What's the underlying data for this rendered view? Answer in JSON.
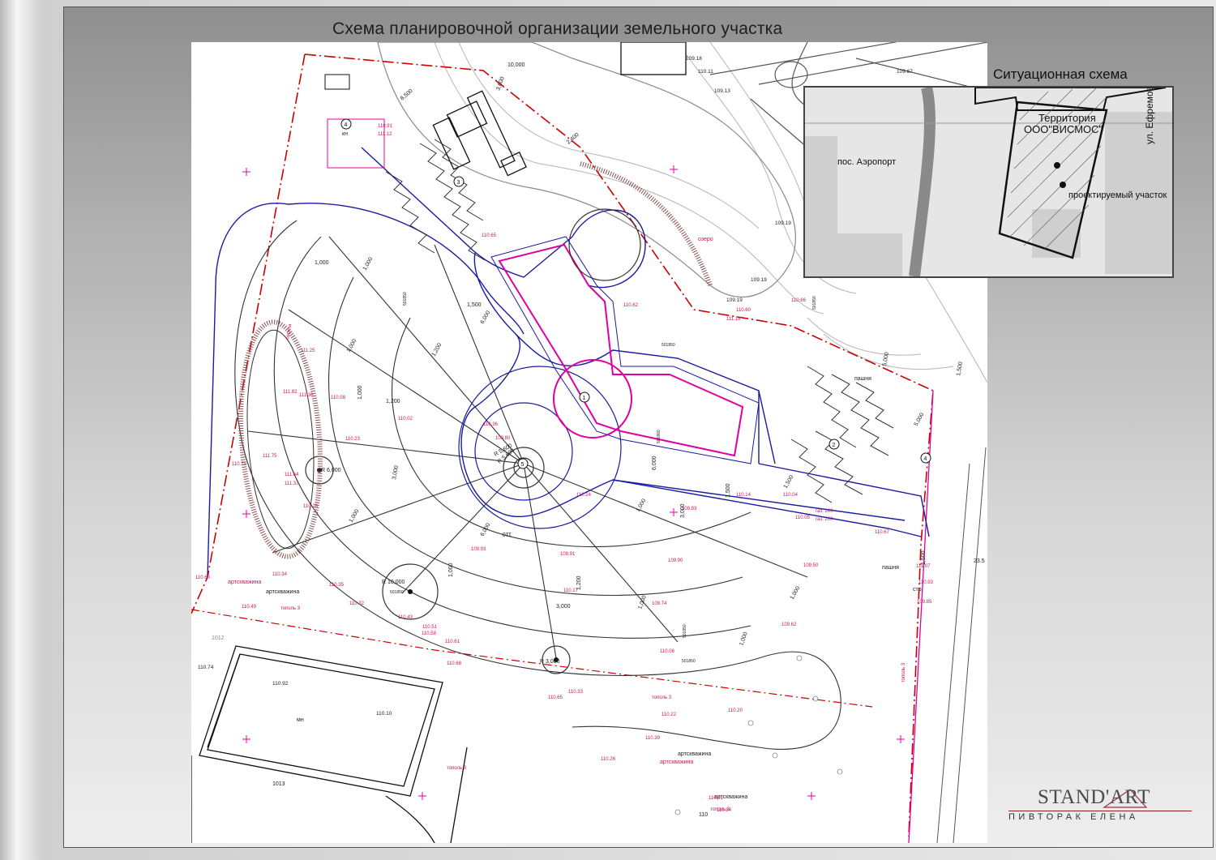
{
  "title": "Схема планировочной организации земельного участка",
  "inset": {
    "title": "Ситуационная схема",
    "territory_label": "Территория",
    "owner_label": "ООО\"ВИСМОС\"",
    "settlement_label": "пос. Аэропорт",
    "street_label": "ул. Ефремова",
    "project_site_label": "проектируемый участок"
  },
  "plan": {
    "text_labels": [
      {
        "text": "пашня",
        "color": "#222",
        "rot": 0
      },
      {
        "text": "пашня",
        "color": "#222",
        "rot": 0
      },
      {
        "text": "артскважина",
        "color": "#d4145a",
        "rot": 0
      },
      {
        "text": "артскважина",
        "color": "#222",
        "rot": 0
      },
      {
        "text": "артскважина",
        "color": "#222",
        "rot": 0
      },
      {
        "text": "артскважина",
        "color": "#222",
        "rot": 0
      },
      {
        "text": "артскважина",
        "color": "#d4145a",
        "rot": 0
      },
      {
        "text": "1013",
        "color": "#222",
        "rot": 0
      },
      {
        "text": "1012",
        "color": "#888",
        "rot": 0
      },
      {
        "text": "мн",
        "color": "#222",
        "rot": 0
      },
      {
        "text": "110",
        "color": "#222",
        "rot": 0
      },
      {
        "text": "110",
        "color": "#222",
        "rot": 180
      },
      {
        "text": "озеро",
        "color": "#d4145a",
        "rot": 0
      },
      {
        "text": "кн",
        "color": "#222",
        "rot": 0
      },
      {
        "text": "стр.",
        "color": "#222",
        "rot": 0
      },
      {
        "text": "23.5",
        "color": "#222",
        "rot": 0
      }
    ],
    "circle_markers": [
      "1",
      "2",
      "3",
      "4",
      "4",
      "5"
    ],
    "elevations_black": [
      "109.18",
      "110.11",
      "109.67",
      "109.13",
      "109.19",
      "109.19",
      "109.19",
      "110.74",
      "110.92",
      "110.10"
    ],
    "elevations_red": [
      "110.91",
      "111.12",
      "110.65",
      "110.62",
      "110.60",
      "111.18",
      "111.25",
      "111.82",
      "111.36",
      "110.08",
      "110.02",
      "110.23",
      "110.70",
      "111.75",
      "111.64",
      "111.37",
      "110.28",
      "110.24",
      "109.83",
      "110.14",
      "110.05",
      "109.93",
      "109.91",
      "109.90",
      "109.50",
      "110.17",
      "109.74",
      "109.62",
      "110.06",
      "110.34",
      "110.35",
      "110.32",
      "110.43",
      "110.51",
      "110.58",
      "110.61",
      "110.68",
      "110.33",
      "110.65",
      "110.22",
      "110.20",
      "110.39",
      "110.26",
      "110.41",
      "110.84",
      "110.60",
      "110.49",
      "110.36",
      "109.80",
      "110.04",
      "110.67",
      "111.07",
      "110.93",
      "109.85",
      "110.66"
    ],
    "dimensions": [
      "1,000",
      "1,000",
      "1,000",
      "1,000",
      "1,000",
      "1,000",
      "1,000",
      "1,000",
      "1,000",
      "1,000",
      "1,200",
      "1,200",
      "1,200",
      "1,500",
      "1,500",
      "1,500",
      "1,500",
      "1,500",
      "3,000",
      "3,000",
      "3,000",
      "5,000",
      "5,000",
      "6,000",
      "6,000",
      "6,000",
      "10,000",
      "8,500",
      "3,600",
      "2,400",
      "R 6,000",
      "R 10,000",
      "R 3,000",
      "R 5,600",
      "R 5,600"
    ],
    "point_ids": [
      "501850",
      "501850",
      "501850",
      "501850",
      "501850",
      "501850",
      "501860"
    ],
    "red_small_labels": [
      "тополь 3",
      "тополь 3",
      "тополь 3",
      "тополь 3",
      "тополь 3",
      "береза",
      "газ. 200",
      "газ. 200"
    ]
  }
}
